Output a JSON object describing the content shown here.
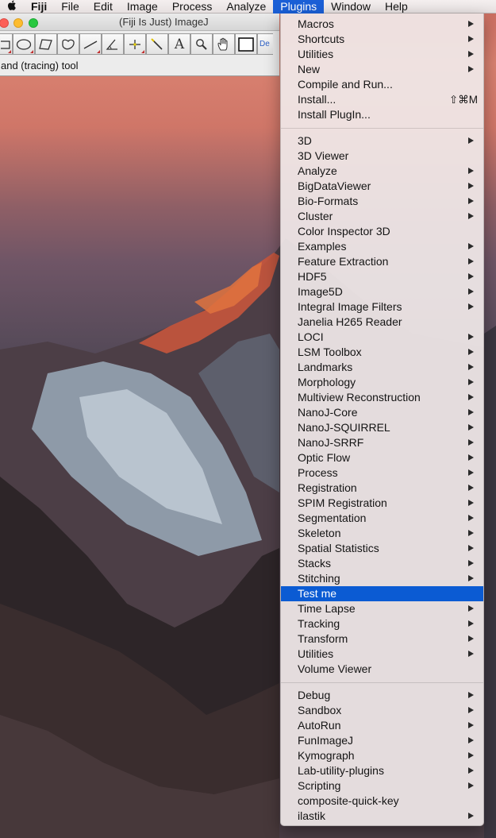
{
  "menubar": {
    "apple_icon": "apple-logo-icon",
    "items": [
      "Fiji",
      "File",
      "Edit",
      "Image",
      "Process",
      "Analyze",
      "Plugins",
      "Window",
      "Help"
    ],
    "active_index": 6,
    "active_color": "#1a5fd6"
  },
  "imagej": {
    "title": "(Fiji Is Just) ImageJ",
    "status": "and (tracing) tool",
    "more_label": "De",
    "tools": [
      {
        "name": "rectangle-tool-icon"
      },
      {
        "name": "oval-tool-icon"
      },
      {
        "name": "polygon-tool-icon"
      },
      {
        "name": "freehand-tool-icon"
      },
      {
        "name": "line-tool-icon"
      },
      {
        "name": "angle-tool-icon"
      },
      {
        "name": "point-tool-icon"
      },
      {
        "name": "wand-tool-icon"
      },
      {
        "name": "text-tool-icon",
        "letter": "A"
      },
      {
        "name": "magnifier-tool-icon"
      },
      {
        "name": "hand-tool-icon"
      },
      {
        "name": "color-picker-tool-icon"
      }
    ]
  },
  "plugins_menu": {
    "highlight_color": "#0b5bd3",
    "groups": [
      [
        {
          "label": "Macros",
          "submenu": true
        },
        {
          "label": "Shortcuts",
          "submenu": true
        },
        {
          "label": "Utilities",
          "submenu": true
        },
        {
          "label": "New",
          "submenu": true
        },
        {
          "label": "Compile and Run...",
          "submenu": false
        },
        {
          "label": "Install...",
          "submenu": false,
          "shortcut": "⇧⌘M"
        },
        {
          "label": "Install PlugIn...",
          "submenu": false
        }
      ],
      [
        {
          "label": "3D",
          "submenu": true
        },
        {
          "label": "3D Viewer",
          "submenu": false
        },
        {
          "label": "Analyze",
          "submenu": true
        },
        {
          "label": "BigDataViewer",
          "submenu": true
        },
        {
          "label": "Bio-Formats",
          "submenu": true
        },
        {
          "label": "Cluster",
          "submenu": true
        },
        {
          "label": "Color Inspector 3D",
          "submenu": false
        },
        {
          "label": "Examples",
          "submenu": true
        },
        {
          "label": "Feature Extraction",
          "submenu": true
        },
        {
          "label": "HDF5",
          "submenu": true
        },
        {
          "label": "Image5D",
          "submenu": true
        },
        {
          "label": "Integral Image Filters",
          "submenu": true
        },
        {
          "label": "Janelia H265 Reader",
          "submenu": false
        },
        {
          "label": "LOCI",
          "submenu": true
        },
        {
          "label": "LSM Toolbox",
          "submenu": true
        },
        {
          "label": "Landmarks",
          "submenu": true
        },
        {
          "label": "Morphology",
          "submenu": true
        },
        {
          "label": "Multiview Reconstruction",
          "submenu": true
        },
        {
          "label": "NanoJ-Core",
          "submenu": true
        },
        {
          "label": "NanoJ-SQUIRREL",
          "submenu": true
        },
        {
          "label": "NanoJ-SRRF",
          "submenu": true
        },
        {
          "label": "Optic Flow",
          "submenu": true
        },
        {
          "label": "Process",
          "submenu": true
        },
        {
          "label": "Registration",
          "submenu": true
        },
        {
          "label": "SPIM Registration",
          "submenu": true
        },
        {
          "label": "Segmentation",
          "submenu": true
        },
        {
          "label": "Skeleton",
          "submenu": true
        },
        {
          "label": "Spatial Statistics",
          "submenu": true
        },
        {
          "label": "Stacks",
          "submenu": true
        },
        {
          "label": "Stitching",
          "submenu": true
        },
        {
          "label": "Test me",
          "submenu": false,
          "highlighted": true
        },
        {
          "label": "Time Lapse",
          "submenu": true
        },
        {
          "label": "Tracking",
          "submenu": true
        },
        {
          "label": "Transform",
          "submenu": true
        },
        {
          "label": "Utilities",
          "submenu": true
        },
        {
          "label": "Volume Viewer",
          "submenu": false
        }
      ],
      [
        {
          "label": "Debug",
          "submenu": true
        },
        {
          "label": "Sandbox",
          "submenu": true
        },
        {
          "label": "AutoRun",
          "submenu": true
        },
        {
          "label": "FunImageJ",
          "submenu": true
        },
        {
          "label": "Kymograph",
          "submenu": true
        },
        {
          "label": "Lab-utility-plugins",
          "submenu": true
        },
        {
          "label": "Scripting",
          "submenu": true
        },
        {
          "label": "composite-quick-key",
          "submenu": false
        },
        {
          "label": "ilastik",
          "submenu": true
        }
      ]
    ]
  }
}
